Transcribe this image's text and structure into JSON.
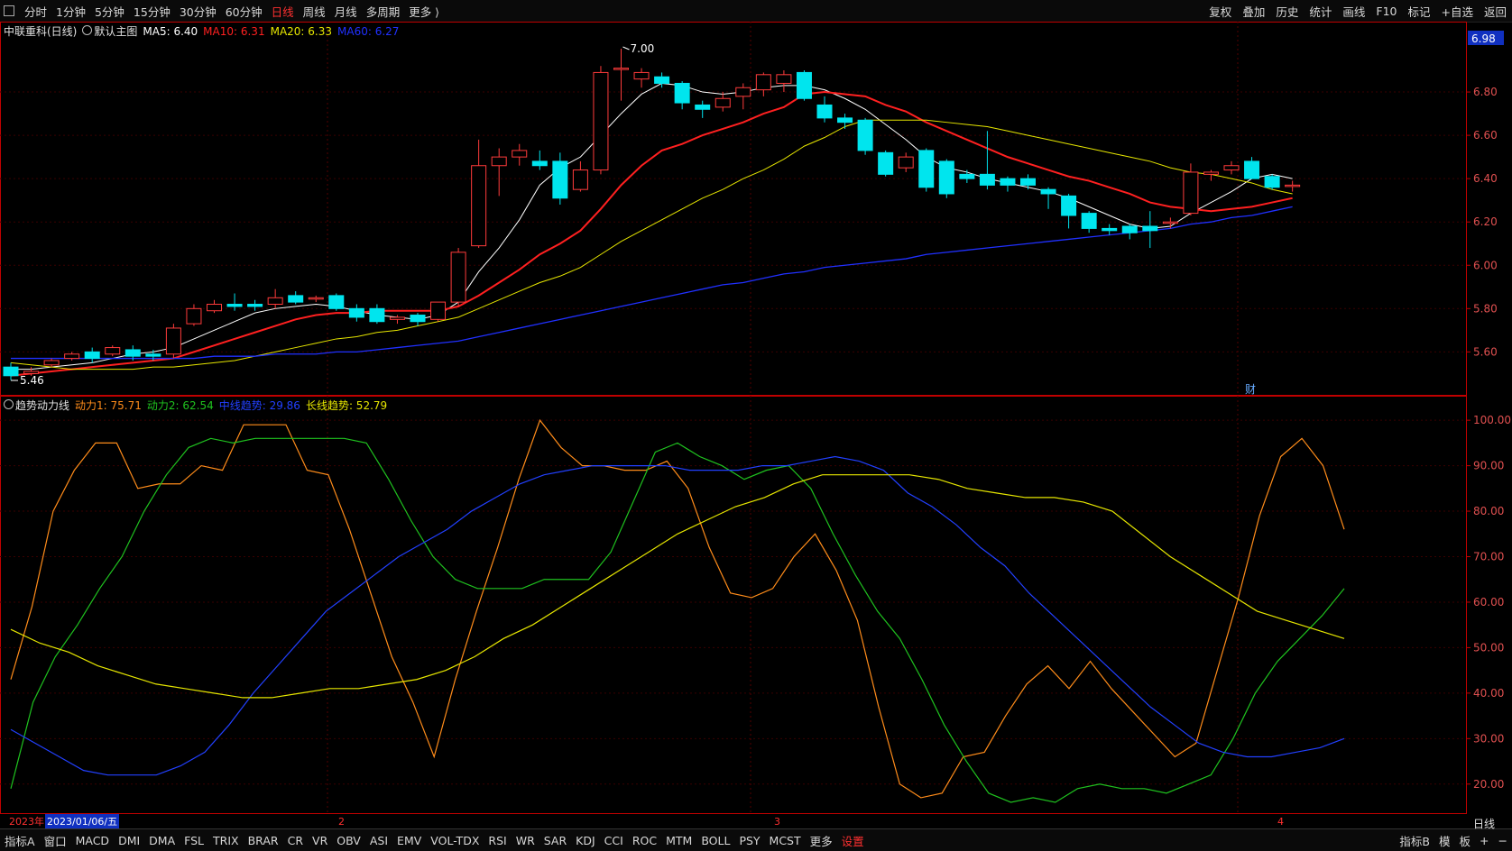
{
  "top_tabs": [
    {
      "label": "分时",
      "active": false
    },
    {
      "label": "1分钟",
      "active": false
    },
    {
      "label": "5分钟",
      "active": false
    },
    {
      "label": "15分钟",
      "active": false
    },
    {
      "label": "30分钟",
      "active": false
    },
    {
      "label": "60分钟",
      "active": false
    },
    {
      "label": "日线",
      "active": true
    },
    {
      "label": "周线",
      "active": false
    },
    {
      "label": "月线",
      "active": false
    },
    {
      "label": "多周期",
      "active": false
    },
    {
      "label": "更多 ⟩",
      "active": false
    }
  ],
  "top_right_tools": [
    "复权",
    "叠加",
    "历史",
    "统计",
    "画线",
    "F10",
    "标记",
    "+自选",
    "返回"
  ],
  "main_legend": {
    "stock": "中联重科(日线)",
    "template": "默认主图",
    "ma5": "MA5: 6.40",
    "ma10": "MA10: 6.31",
    "ma20": "MA20: 6.33",
    "ma60": "MA60: 6.27"
  },
  "ind_legend": {
    "name": "趋势动力线",
    "d1": "动力1: 75.71",
    "d2": "动力2: 62.54",
    "mid": "中线趋势: 29.86",
    "long": "长线趋势: 52.79"
  },
  "current_price_tag": "6.98",
  "high_label": "7.00",
  "low_label": "5.46",
  "event_marker": "财",
  "date_strip": {
    "year": "2023年",
    "date": "2023/01/06/五",
    "months": [
      "2",
      "3",
      "4"
    ]
  },
  "bottom_tabs": [
    "指标A",
    "窗口",
    "MACD",
    "DMI",
    "DMA",
    "FSL",
    "TRIX",
    "BRAR",
    "CR",
    "VR",
    "OBV",
    "ASI",
    "EMV",
    "VOL-TDX",
    "RSI",
    "WR",
    "SAR",
    "KDJ",
    "CCI",
    "ROC",
    "MTM",
    "BOLL",
    "PSY",
    "MCST",
    "更多",
    "设置"
  ],
  "bottom_right": [
    "指标B",
    "模",
    "板",
    "+",
    "−"
  ],
  "period_label": "日线",
  "colors": {
    "up": "#ff3b3b",
    "down": "#00e5ee",
    "ma5": "#ffffff",
    "ma10": "#ff2020",
    "ma20": "#e6e600",
    "ma60": "#2030ff",
    "d1": "#ff8c1a",
    "d2": "#1fc21f",
    "mid": "#2240ff",
    "long": "#e6e600",
    "axis": "#c00000",
    "grid": "#3a0000"
  },
  "chart_data": [
    {
      "type": "candlestick",
      "title": "中联重科(日线)",
      "ylim": [
        5.46,
        7.0
      ],
      "y_ticks": [
        5.6,
        5.8,
        6.0,
        6.2,
        6.4,
        6.6,
        6.8
      ],
      "x_month_labels": [
        "2",
        "3",
        "4"
      ],
      "candles": [
        [
          5.53,
          5.49,
          5.55,
          5.47
        ],
        [
          5.5,
          5.51,
          5.53,
          5.49
        ],
        [
          5.54,
          5.56,
          5.57,
          5.53
        ],
        [
          5.57,
          5.59,
          5.6,
          5.56
        ],
        [
          5.6,
          5.57,
          5.62,
          5.55
        ],
        [
          5.59,
          5.62,
          5.63,
          5.58
        ],
        [
          5.61,
          5.58,
          5.63,
          5.56
        ],
        [
          5.59,
          5.58,
          5.61,
          5.56
        ],
        [
          5.59,
          5.71,
          5.73,
          5.57
        ],
        [
          5.73,
          5.8,
          5.82,
          5.72
        ],
        [
          5.79,
          5.82,
          5.84,
          5.78
        ],
        [
          5.82,
          5.81,
          5.87,
          5.79
        ],
        [
          5.82,
          5.81,
          5.84,
          5.79
        ],
        [
          5.82,
          5.85,
          5.89,
          5.8
        ],
        [
          5.86,
          5.83,
          5.88,
          5.82
        ],
        [
          5.85,
          5.85,
          5.86,
          5.83
        ],
        [
          5.86,
          5.8,
          5.87,
          5.79
        ],
        [
          5.8,
          5.76,
          5.82,
          5.74
        ],
        [
          5.8,
          5.74,
          5.82,
          5.73
        ],
        [
          5.75,
          5.76,
          5.77,
          5.73
        ],
        [
          5.77,
          5.74,
          5.78,
          5.72
        ],
        [
          5.75,
          5.83,
          5.83,
          5.74
        ],
        [
          5.83,
          6.06,
          6.08,
          5.81
        ],
        [
          6.09,
          6.46,
          6.58,
          6.08
        ],
        [
          6.46,
          6.5,
          6.54,
          6.32
        ],
        [
          6.5,
          6.53,
          6.56,
          6.46
        ],
        [
          6.48,
          6.46,
          6.53,
          6.44
        ],
        [
          6.48,
          6.31,
          6.52,
          6.28
        ],
        [
          6.35,
          6.44,
          6.48,
          6.34
        ],
        [
          6.44,
          6.89,
          6.92,
          6.42
        ],
        [
          6.91,
          6.91,
          7.0,
          6.76
        ],
        [
          6.86,
          6.89,
          6.91,
          6.82
        ],
        [
          6.87,
          6.84,
          6.89,
          6.82
        ],
        [
          6.84,
          6.75,
          6.85,
          6.72
        ],
        [
          6.74,
          6.72,
          6.76,
          6.68
        ],
        [
          6.73,
          6.77,
          6.8,
          6.71
        ],
        [
          6.78,
          6.82,
          6.84,
          6.72
        ],
        [
          6.81,
          6.88,
          6.89,
          6.78
        ],
        [
          6.84,
          6.88,
          6.9,
          6.8
        ],
        [
          6.89,
          6.77,
          6.9,
          6.76
        ],
        [
          6.74,
          6.68,
          6.78,
          6.66
        ],
        [
          6.68,
          6.66,
          6.7,
          6.63
        ],
        [
          6.67,
          6.53,
          6.68,
          6.51
        ],
        [
          6.52,
          6.42,
          6.53,
          6.41
        ],
        [
          6.45,
          6.5,
          6.52,
          6.43
        ],
        [
          6.53,
          6.36,
          6.54,
          6.34
        ],
        [
          6.48,
          6.33,
          6.49,
          6.31
        ],
        [
          6.42,
          6.4,
          6.44,
          6.38
        ],
        [
          6.42,
          6.37,
          6.62,
          6.35
        ],
        [
          6.4,
          6.37,
          6.41,
          6.34
        ],
        [
          6.4,
          6.37,
          6.42,
          6.35
        ],
        [
          6.35,
          6.33,
          6.36,
          6.26
        ],
        [
          6.32,
          6.23,
          6.33,
          6.17
        ],
        [
          6.24,
          6.17,
          6.25,
          6.15
        ],
        [
          6.17,
          6.16,
          6.19,
          6.14
        ],
        [
          6.18,
          6.15,
          6.19,
          6.12
        ],
        [
          6.18,
          6.16,
          6.25,
          6.08
        ],
        [
          6.2,
          6.2,
          6.22,
          6.17
        ],
        [
          6.24,
          6.43,
          6.47,
          6.23
        ],
        [
          6.42,
          6.43,
          6.44,
          6.39
        ],
        [
          6.44,
          6.46,
          6.48,
          6.42
        ],
        [
          6.48,
          6.4,
          6.5,
          6.4
        ],
        [
          6.41,
          6.36,
          6.42,
          6.35
        ],
        [
          6.37,
          6.37,
          6.39,
          6.34
        ]
      ],
      "ma": {
        "MA5": [
          5.52,
          5.52,
          5.53,
          5.54,
          5.55,
          5.57,
          5.59,
          5.6,
          5.62,
          5.66,
          5.7,
          5.74,
          5.78,
          5.8,
          5.81,
          5.82,
          5.81,
          5.79,
          5.77,
          5.76,
          5.75,
          5.77,
          5.83,
          5.97,
          6.08,
          6.21,
          6.37,
          6.45,
          6.5,
          6.6,
          6.7,
          6.79,
          6.84,
          6.83,
          6.8,
          6.79,
          6.8,
          6.82,
          6.83,
          6.83,
          6.81,
          6.77,
          6.72,
          6.65,
          6.58,
          6.5,
          6.45,
          6.43,
          6.4,
          6.38,
          6.36,
          6.34,
          6.31,
          6.27,
          6.23,
          6.19,
          6.17,
          6.18,
          6.24,
          6.29,
          6.34,
          6.4,
          6.42,
          6.4
        ],
        "MA10": [
          5.49,
          5.5,
          5.51,
          5.52,
          5.53,
          5.54,
          5.55,
          5.56,
          5.57,
          5.6,
          5.63,
          5.66,
          5.69,
          5.72,
          5.75,
          5.77,
          5.78,
          5.78,
          5.79,
          5.79,
          5.79,
          5.79,
          5.81,
          5.86,
          5.92,
          5.98,
          6.05,
          6.1,
          6.16,
          6.26,
          6.37,
          6.46,
          6.53,
          6.56,
          6.6,
          6.63,
          6.66,
          6.7,
          6.73,
          6.79,
          6.8,
          6.79,
          6.78,
          6.74,
          6.71,
          6.66,
          6.62,
          6.58,
          6.54,
          6.5,
          6.47,
          6.44,
          6.41,
          6.39,
          6.36,
          6.33,
          6.29,
          6.27,
          6.26,
          6.25,
          6.26,
          6.27,
          6.29,
          6.31
        ],
        "MA20": [
          5.55,
          5.54,
          5.53,
          5.52,
          5.52,
          5.52,
          5.52,
          5.53,
          5.53,
          5.54,
          5.55,
          5.56,
          5.58,
          5.6,
          5.62,
          5.64,
          5.66,
          5.67,
          5.69,
          5.7,
          5.72,
          5.74,
          5.76,
          5.8,
          5.84,
          5.88,
          5.92,
          5.95,
          5.99,
          6.05,
          6.11,
          6.16,
          6.21,
          6.26,
          6.31,
          6.35,
          6.4,
          6.44,
          6.49,
          6.55,
          6.59,
          6.64,
          6.67,
          6.67,
          6.67,
          6.67,
          6.66,
          6.65,
          6.64,
          6.62,
          6.6,
          6.58,
          6.56,
          6.54,
          6.52,
          6.5,
          6.48,
          6.45,
          6.43,
          6.42,
          6.4,
          6.38,
          6.35,
          6.33
        ],
        "MA60": [
          5.57,
          5.57,
          5.57,
          5.57,
          5.57,
          5.57,
          5.57,
          5.57,
          5.57,
          5.57,
          5.58,
          5.58,
          5.58,
          5.59,
          5.59,
          5.59,
          5.6,
          5.6,
          5.61,
          5.62,
          5.63,
          5.64,
          5.65,
          5.67,
          5.69,
          5.71,
          5.73,
          5.75,
          5.77,
          5.79,
          5.81,
          5.83,
          5.85,
          5.87,
          5.89,
          5.91,
          5.92,
          5.94,
          5.96,
          5.97,
          5.99,
          6.0,
          6.01,
          6.02,
          6.03,
          6.05,
          6.06,
          6.07,
          6.08,
          6.09,
          6.1,
          6.11,
          6.12,
          6.13,
          6.14,
          6.15,
          6.16,
          6.17,
          6.19,
          6.2,
          6.22,
          6.23,
          6.25,
          6.27
        ]
      }
    },
    {
      "type": "line",
      "title": "趋势动力线",
      "ylim": [
        15,
        103
      ],
      "y_ticks": [
        20,
        30,
        40,
        50,
        60,
        70,
        80,
        90,
        100
      ],
      "series": [
        {
          "name": "动力1",
          "values": [
            43,
            59,
            80,
            89,
            95,
            95,
            85,
            86,
            86,
            90,
            89,
            99,
            99,
            99,
            89,
            88,
            76,
            62,
            48,
            38,
            26,
            43,
            58,
            72,
            87,
            100,
            94,
            90,
            90,
            89,
            89,
            91,
            85,
            72,
            62,
            61,
            63,
            70,
            75,
            67,
            56,
            37,
            20,
            17,
            18,
            26,
            27,
            35,
            42,
            46,
            41,
            47,
            41,
            36,
            31,
            26,
            29,
            45,
            61,
            79,
            92,
            96,
            90,
            76
          ]
        },
        {
          "name": "动力2",
          "values": [
            19,
            38,
            48,
            55,
            63,
            70,
            80,
            88,
            94,
            96,
            95,
            96,
            96,
            96,
            96,
            96,
            95,
            87,
            78,
            70,
            65,
            63,
            63,
            63,
            65,
            65,
            65,
            71,
            82,
            93,
            95,
            92,
            90,
            87,
            89,
            90,
            85,
            75,
            66,
            58,
            52,
            43,
            33,
            25,
            18,
            16,
            17,
            16,
            19,
            20,
            19,
            19,
            18,
            20,
            22,
            30,
            40,
            47,
            52,
            57,
            63
          ]
        },
        {
          "name": "中线趋势",
          "values": [
            32,
            29,
            26,
            23,
            22,
            22,
            22,
            24,
            27,
            33,
            40,
            46,
            52,
            58,
            62,
            66,
            70,
            73,
            76,
            80,
            83,
            86,
            88,
            89,
            90,
            90,
            90,
            90,
            89,
            89,
            89,
            90,
            90,
            91,
            92,
            91,
            89,
            84,
            81,
            77,
            72,
            68,
            62,
            57,
            52,
            47,
            42,
            37,
            33,
            29,
            27,
            26,
            26,
            27,
            28,
            30
          ]
        },
        {
          "name": "长线趋势",
          "values": [
            54,
            51,
            49,
            46,
            44,
            42,
            41,
            40,
            39,
            39,
            40,
            41,
            41,
            42,
            43,
            45,
            48,
            52,
            55,
            59,
            63,
            67,
            71,
            75,
            78,
            81,
            83,
            86,
            88,
            88,
            88,
            88,
            87,
            85,
            84,
            83,
            83,
            82,
            80,
            75,
            70,
            66,
            62,
            58,
            56,
            54,
            52
          ]
        }
      ]
    }
  ]
}
